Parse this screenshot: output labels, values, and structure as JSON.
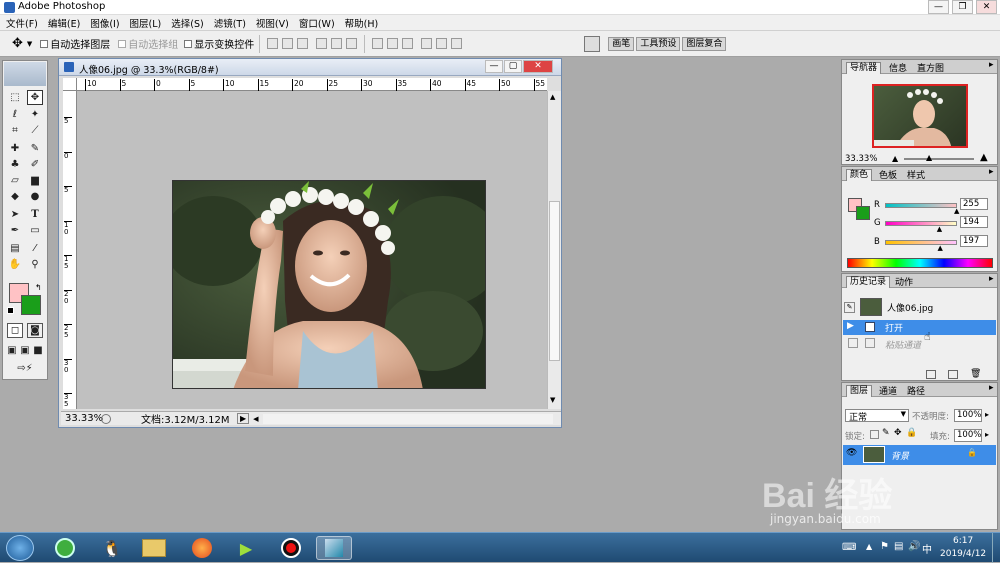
{
  "app": {
    "title": "Adobe Photoshop"
  },
  "menu": [
    "文件(F)",
    "编辑(E)",
    "图像(I)",
    "图层(L)",
    "选择(S)",
    "滤镜(T)",
    "视图(V)",
    "窗口(W)",
    "帮助(H)"
  ],
  "options": {
    "auto_select_layer": "自动选择图层",
    "auto_select_group": "自动选择组",
    "show_transform": "显示变换控件",
    "panel_tabs": [
      "画笔",
      "工具预设",
      "图层复合"
    ]
  },
  "document": {
    "title": "人像06.jpg @ 33.3%(RGB/8#)",
    "zoom": "33.33%",
    "doc_info": "文档:3.12M/3.12M",
    "ruler_h_ticks": [
      "10",
      "5",
      "0",
      "5",
      "10",
      "15",
      "20",
      "25",
      "30",
      "35",
      "40",
      "45",
      "50",
      "55"
    ],
    "ruler_v_ticks": [
      "5",
      "0",
      "5",
      "1 0",
      "1 5",
      "2 0",
      "2 5",
      "3 0",
      "3 5"
    ]
  },
  "navigator": {
    "tabs": [
      "导航器",
      "信息",
      "直方图"
    ],
    "zoom": "33.33%"
  },
  "color": {
    "tabs": [
      "颜色",
      "色板",
      "样式"
    ],
    "r_label": "R",
    "g_label": "G",
    "b_label": "B",
    "r": "255",
    "g": "194",
    "b": "197",
    "r_frac": 1.0,
    "g_frac": 0.76,
    "b_frac": 0.77,
    "foreground": "#ffc2c5",
    "background": "#1a9e1a"
  },
  "history": {
    "tabs": [
      "历史记录",
      "动作"
    ],
    "snapshot": "人像06.jpg",
    "items": [
      "打开",
      "粘贴通道"
    ]
  },
  "layers": {
    "tabs": [
      "图层",
      "通道",
      "路径"
    ],
    "blend_mode": "正常",
    "opacity_label": "不透明度:",
    "opacity": "100%",
    "lock_label": "锁定:",
    "fill_label": "填充:",
    "fill": "100%",
    "layer_name": "背景"
  },
  "watermark": {
    "text": "Bai 经验",
    "url": "jingyan.baidu.com"
  },
  "taskbar": {
    "time": "6:17",
    "date": "2019/4/12"
  }
}
